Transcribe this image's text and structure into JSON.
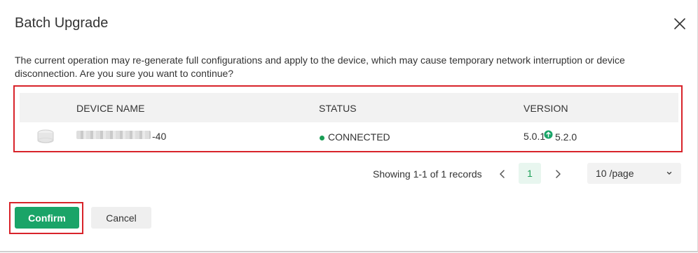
{
  "dialog": {
    "title": "Batch Upgrade",
    "close_icon": "close-icon",
    "message": "The current operation may re-generate full configurations and apply to the device, which may cause temporary network interruption or device disconnection. Are you sure you want to continue?"
  },
  "table": {
    "columns": [
      "DEVICE NAME",
      "STATUS",
      "VERSION"
    ],
    "rows": [
      {
        "icon": "access-point-icon",
        "name_visible_suffix": "-40",
        "status": "CONNECTED",
        "status_color": "#1a9e55",
        "version_current": "5.0.1",
        "upgrade_icon": "arrow-up-circle-icon",
        "version_target": "5.2.0"
      }
    ]
  },
  "pagination": {
    "records_text": "Showing 1-1 of 1 records",
    "current_page": "1",
    "page_size": "10 /page"
  },
  "footer": {
    "confirm_label": "Confirm",
    "cancel_label": "Cancel"
  },
  "colors": {
    "accent": "#1aa468",
    "highlight_outline": "#d8232a"
  }
}
